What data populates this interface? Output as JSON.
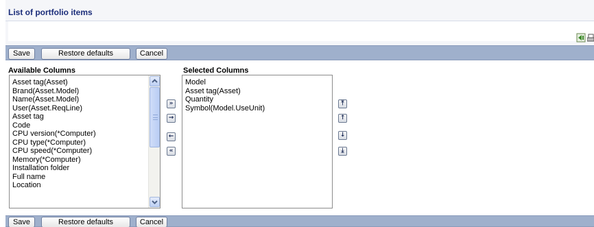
{
  "page": {
    "title": "List of portfolio items"
  },
  "header_icons": [
    "export-icon",
    "print-icon"
  ],
  "toolbar": {
    "save_label": "Save",
    "restore_label": "Restore defaults",
    "cancel_label": "Cancel"
  },
  "available": {
    "label": "Available Columns",
    "items": [
      "Asset tag(Asset)",
      "Brand(Asset.Model)",
      "Name(Asset.Model)",
      "User(Asset.ReqLine)",
      "Asset tag",
      "Code",
      "CPU version(*Computer)",
      "CPU type(*Computer)",
      "CPU speed(*Computer)",
      "Memory(*Computer)",
      "Installation folder",
      "Full name",
      "Location"
    ]
  },
  "selected": {
    "label": "Selected Columns",
    "items": [
      "Model",
      "Asset tag(Asset)",
      "Quantity",
      "Symbol(Model.UseUnit)"
    ]
  },
  "transfer_buttons": {
    "add_all": "»",
    "add": "→",
    "remove": "←",
    "remove_all": "«"
  },
  "order_buttons": {
    "move_top": "⤒",
    "move_up": "↑",
    "move_down": "↓",
    "move_bottom": "⤓"
  },
  "colors": {
    "title": "#1b2d7a",
    "toolbar": "#9fb0cc"
  }
}
